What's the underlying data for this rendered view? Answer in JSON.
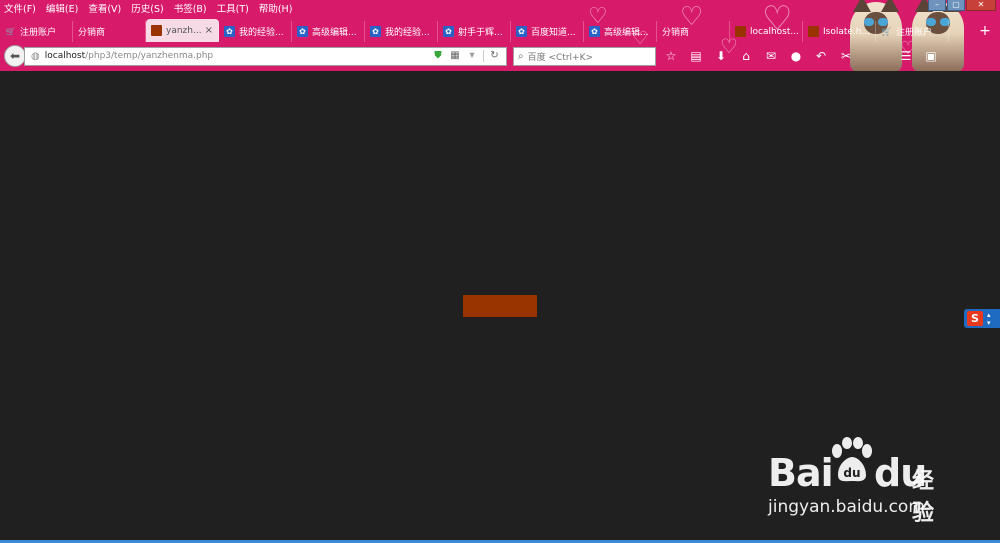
{
  "menubar": {
    "items": [
      "文件(F)",
      "编辑(E)",
      "查看(V)",
      "历史(S)",
      "书签(B)",
      "工具(T)",
      "帮助(H)"
    ]
  },
  "tabs": [
    {
      "label": "注册账户",
      "icon": "cart-icon",
      "active": false
    },
    {
      "label": "分销商",
      "icon": "",
      "active": false
    },
    {
      "label": "yanzh...",
      "icon": "page-icon",
      "active": true
    },
    {
      "label": "我的经验...",
      "icon": "paw-icon",
      "active": false
    },
    {
      "label": "高级编辑...",
      "icon": "paw-icon",
      "active": false
    },
    {
      "label": "我的经验...",
      "icon": "paw-icon",
      "active": false
    },
    {
      "label": "射手于辉...",
      "icon": "paw-icon",
      "active": false
    },
    {
      "label": "百度知道...",
      "icon": "paw-icon",
      "active": false
    },
    {
      "label": "高级编辑...",
      "icon": "paw-icon",
      "active": false
    },
    {
      "label": "分销商",
      "icon": "",
      "active": false
    },
    {
      "label": "localhost...",
      "icon": "page-icon",
      "active": false
    },
    {
      "label": "Isolate.h...",
      "icon": "page-icon",
      "active": false
    },
    {
      "label": "注册账户",
      "icon": "cart-icon",
      "active": false
    }
  ],
  "new_tab_label": "+",
  "tab_close_glyph": "×",
  "urlbar": {
    "host": "localhost",
    "path": "/php3/temp/yanzhenma.php"
  },
  "search": {
    "placeholder": "百度 <Ctrl+K>"
  },
  "page": {
    "background": "#202020",
    "captcha_color": "#993300"
  },
  "ime": {
    "letter": "S"
  },
  "watermark": {
    "bai": "Bai",
    "du": "du",
    "jingyan": "经验",
    "url": "jingyan.baidu.com"
  },
  "colors": {
    "chrome": "#d81a6a",
    "active_tab": "#f6dbe7"
  }
}
